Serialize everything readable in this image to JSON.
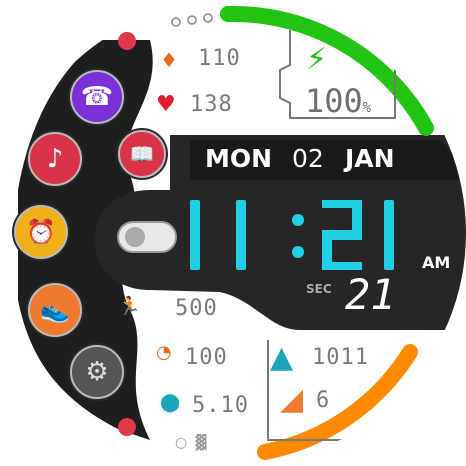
{
  "date": {
    "weekday": "MON",
    "day": "02",
    "month": "JAN"
  },
  "time": {
    "hours": "11",
    "minutes": "21",
    "ampm": "AM",
    "sec_label": "SEC",
    "seconds": "21"
  },
  "battery": {
    "percent_text": "100",
    "percent_sign": "%",
    "level": 1.0,
    "color": "#22c414"
  },
  "health": {
    "heart_value_a": "110",
    "heart_rate": "138"
  },
  "activity": {
    "steps": "500",
    "calories": "100",
    "distance": "5.10"
  },
  "weather": {
    "high": "1011",
    "low": "6"
  },
  "progress_arc": {
    "color": "#ff8a00",
    "level": 0.6
  },
  "apps": [
    {
      "name": "phone",
      "color": "#7b2fd6"
    },
    {
      "name": "music",
      "color": "#d9334a"
    },
    {
      "name": "alarm",
      "color": "#f0b018"
    },
    {
      "name": "workout",
      "color": "#f07a30"
    },
    {
      "name": "settings",
      "color": "#555555"
    }
  ],
  "accent_cyan": "#1fd0e6"
}
